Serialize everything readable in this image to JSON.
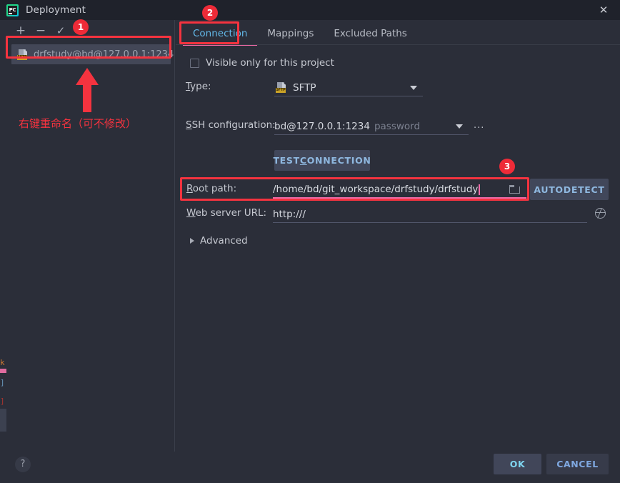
{
  "window": {
    "title": "Deployment",
    "app_icon": "pycharm-logo-icon",
    "close_icon": "close-icon"
  },
  "left_panel": {
    "toolbar": [
      {
        "name": "add-server-button",
        "glyph": "+"
      },
      {
        "name": "remove-server-button",
        "glyph": "−"
      },
      {
        "name": "set-default-server-button",
        "glyph": "✓"
      }
    ],
    "servers": [
      {
        "label": "drfstudy@bd@127.0.0.1:1234",
        "icon": "sftp-server-icon",
        "icon_tag": "SFTP",
        "selected": true
      }
    ]
  },
  "tabs": [
    {
      "label": "Connection",
      "active": true
    },
    {
      "label": "Mappings",
      "active": false
    },
    {
      "label": "Excluded Paths",
      "active": false
    }
  ],
  "connection": {
    "visible_only_checkbox": {
      "label": "Visible only for this project",
      "checked": false
    },
    "type": {
      "label": "Type:",
      "mnemonic": "T",
      "value": "SFTP",
      "icon": "sftp-type-icon",
      "icon_tag": "SFTP",
      "caret": "chevron-down-icon"
    },
    "ssh_configuration": {
      "label": "SSH configuration:",
      "mnemonic": "S",
      "value": "bd@127.0.0.1:1234",
      "auth": "password",
      "caret": "chevron-down-icon",
      "more_button": "..."
    },
    "test_connection_button": {
      "label_pre": "TEST ",
      "label_mnemonic": "C",
      "label_post": "ONNECTION"
    },
    "root_path": {
      "label": "Root path:",
      "mnemonic": "R",
      "value": "/home/bd/git_workspace/drfstudy/drfstudy",
      "browse_icon": "folder-browse-icon"
    },
    "autodetect_button": {
      "label": "AUTODETECT"
    },
    "web_server_url": {
      "label": "Web server URL:",
      "mnemonic": "W",
      "value": "http:///",
      "open_icon": "globe-open-in-browser-icon"
    },
    "advanced": {
      "label": "Advanced",
      "expanded": false,
      "icon": "chevron-right-icon"
    }
  },
  "footer": {
    "help_button": {
      "label": "?",
      "icon": "help-icon"
    },
    "ok_button": {
      "label": "OK"
    },
    "cancel_button": {
      "label": "CANCEL"
    }
  },
  "annotations": {
    "accent_color": "#f5333f",
    "badges": [
      {
        "number": "1"
      },
      {
        "number": "2"
      },
      {
        "number": "3"
      }
    ],
    "note": "右键重命名（可不修改）",
    "arrow": "up-arrow"
  }
}
